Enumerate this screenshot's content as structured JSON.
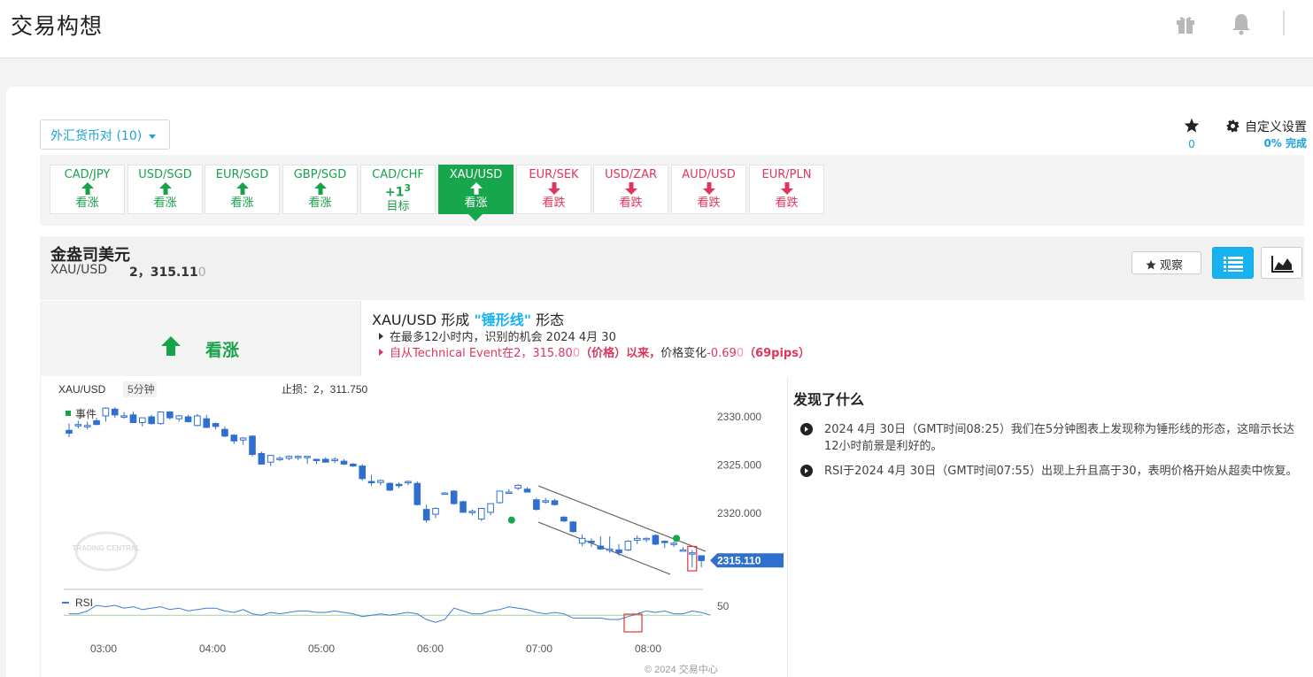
{
  "app": {
    "title": "交易构想"
  },
  "icons": {
    "gift": "gift-icon",
    "bell": "bell-icon",
    "star": "star-icon",
    "gear": "gear-icon",
    "list": "list-icon",
    "area_chart": "area-chart-icon"
  },
  "filter": {
    "label": "外汇货币对 (10)"
  },
  "watchlist": {
    "count": "0"
  },
  "custom_settings": {
    "label": "自定义设置",
    "progress": "0% 完成",
    "progress_value": 0
  },
  "pairs": [
    {
      "symbol": "CAD/JPY",
      "bias": "up",
      "label": "看涨"
    },
    {
      "symbol": "USD/SGD",
      "bias": "up",
      "label": "看涨"
    },
    {
      "symbol": "EUR/SGD",
      "bias": "up",
      "label": "看涨"
    },
    {
      "symbol": "GBP/SGD",
      "bias": "up",
      "label": "看涨"
    },
    {
      "symbol": "CAD/CHF",
      "bias": "target",
      "target_value": "+1",
      "target_sup": "3",
      "label": "目标"
    },
    {
      "symbol": "XAU/USD",
      "bias": "up",
      "label": "看涨",
      "active": true
    },
    {
      "symbol": "EUR/SEK",
      "bias": "down",
      "label": "看跌"
    },
    {
      "symbol": "USD/ZAR",
      "bias": "down",
      "label": "看跌"
    },
    {
      "symbol": "AUD/USD",
      "bias": "down",
      "label": "看跌"
    },
    {
      "symbol": "EUR/PLN",
      "bias": "down",
      "label": "看跌"
    }
  ],
  "instrument": {
    "name": "金盎司美元",
    "symbol": "XAU/USD",
    "price_main": "2，315.11",
    "price_dim": "0"
  },
  "buttons": {
    "watch": "观察"
  },
  "bias": {
    "label": "看涨",
    "color": "#18a34a"
  },
  "pattern": {
    "prefix": "XAU/USD 形成 ",
    "name": "\"锤形线\"",
    "suffix": " 形态",
    "bullet1": "在最多12小时内，识别的机会 2024 4月 30",
    "bullet2_a": "自从Technical Event在2，315.80",
    "bullet2_dim1": "0",
    "bullet2_b": "（价格）以来，",
    "bullet2_c": "价格变化",
    "bullet2_d": "-0.69",
    "bullet2_dim2": "0",
    "bullet2_e": "（69pips）"
  },
  "chart_data": {
    "type": "candlestick",
    "symbol": "XAU/USD",
    "timeframe": "5分钟",
    "stop_loss": "止损：2，311.750",
    "legend": "事件",
    "rsi_label": "RSI",
    "rsi_level": "50",
    "yticks": [
      "2330.000",
      "2325.000",
      "2320.000"
    ],
    "ytick_values": [
      2330,
      2325,
      2320
    ],
    "last_price": "2315.110",
    "last_price_value": 2315.11,
    "xticks": [
      "03:00",
      "04:00",
      "05:00",
      "06:00",
      "07:00",
      "08:00"
    ],
    "xtick_minutes": [
      180,
      240,
      300,
      360,
      420,
      480
    ],
    "copyright": "© 2024 交易中心",
    "watermark": "TRADING CENTRAL",
    "candles": [
      [
        2328.6,
        2329.3,
        2327.9,
        2328.3
      ],
      [
        2329.1,
        2329.6,
        2328.8,
        2329.2
      ],
      [
        2329.0,
        2329.5,
        2328.7,
        2329.1
      ],
      [
        2329.6,
        2329.9,
        2329.3,
        2329.2
      ],
      [
        2330.1,
        2331.0,
        2329.5,
        2330.9
      ],
      [
        2330.8,
        2331.0,
        2329.9,
        2330.2
      ],
      [
        2330.1,
        2330.5,
        2329.8,
        2330.1
      ],
      [
        2330.2,
        2330.5,
        2329.6,
        2329.4
      ],
      [
        2329.4,
        2329.9,
        2329.0,
        2329.9
      ],
      [
        2330.0,
        2330.2,
        2329.2,
        2329.3
      ],
      [
        2329.3,
        2330.4,
        2329.2,
        2330.5
      ],
      [
        2330.5,
        2330.6,
        2329.7,
        2329.9
      ],
      [
        2329.8,
        2330.2,
        2329.5,
        2330.1
      ],
      [
        2330.0,
        2330.2,
        2329.4,
        2329.5
      ],
      [
        2329.1,
        2330.3,
        2329.0,
        2330.1
      ],
      [
        2329.8,
        2330.2,
        2328.9,
        2328.9
      ],
      [
        2329.3,
        2329.4,
        2328.7,
        2329.0
      ],
      [
        2328.7,
        2329.0,
        2327.9,
        2328.0
      ],
      [
        2328.1,
        2328.2,
        2327.2,
        2327.5
      ],
      [
        2327.6,
        2327.9,
        2327.1,
        2327.8
      ],
      [
        2328.0,
        2328.1,
        2325.9,
        2326.1
      ],
      [
        2326.2,
        2326.4,
        2325.1,
        2325.1
      ],
      [
        2325.3,
        2325.6,
        2324.9,
        2326.0
      ],
      [
        2325.6,
        2325.9,
        2325.4,
        2325.7
      ],
      [
        2325.7,
        2326.0,
        2325.5,
        2325.9
      ],
      [
        2325.9,
        2326.0,
        2325.5,
        2325.9
      ],
      [
        2325.9,
        2325.9,
        2325.1,
        2325.9
      ],
      [
        2325.6,
        2325.6,
        2325.1,
        2325.5
      ],
      [
        2325.6,
        2325.8,
        2325.3,
        2325.3
      ],
      [
        2325.5,
        2325.8,
        2325.2,
        2325.6
      ],
      [
        2325.4,
        2325.6,
        2325.0,
        2325.1
      ],
      [
        2325.1,
        2325.2,
        2324.8,
        2324.9
      ],
      [
        2324.9,
        2325.1,
        2323.4,
        2323.6
      ],
      [
        2323.3,
        2324.0,
        2322.8,
        2323.2
      ],
      [
        2323.2,
        2323.5,
        2322.9,
        2323.4
      ],
      [
        2323.1,
        2323.2,
        2322.3,
        2322.4
      ],
      [
        2323.0,
        2323.2,
        2322.6,
        2322.9
      ],
      [
        2323.3,
        2323.4,
        2322.9,
        2323.3
      ],
      [
        2323.1,
        2323.3,
        2320.8,
        2320.9
      ],
      [
        2320.4,
        2320.9,
        2319.0,
        2319.3
      ],
      [
        2319.9,
        2320.6,
        2319.5,
        2320.5
      ],
      [
        2322.1,
        2322.2,
        2322.0,
        2322.1
      ],
      [
        2322.3,
        2322.4,
        2320.9,
        2321.0
      ],
      [
        2321.2,
        2321.3,
        2320.1,
        2320.1
      ],
      [
        2320.2,
        2320.4,
        2319.8,
        2320.2
      ],
      [
        2319.4,
        2320.5,
        2319.2,
        2320.5
      ],
      [
        2320.1,
        2321.0,
        2319.8,
        2321.0
      ],
      [
        2321.1,
        2322.3,
        2321.0,
        2322.3
      ],
      [
        2322.2,
        2322.5,
        2322.0,
        2322.2
      ],
      [
        2322.6,
        2323.0,
        2322.4,
        2322.9
      ],
      [
        2322.5,
        2322.7,
        2322.2,
        2322.2
      ],
      [
        2321.4,
        2321.6,
        2320.3,
        2320.4
      ],
      [
        2321.2,
        2321.6,
        2321.0,
        2321.3
      ],
      [
        2321.3,
        2321.5,
        2320.8,
        2320.9
      ],
      [
        2319.6,
        2319.7,
        2319.1,
        2319.2
      ],
      [
        2319.1,
        2319.2,
        2318.0,
        2318.1
      ],
      [
        2316.9,
        2317.8,
        2316.6,
        2317.4
      ],
      [
        2317.1,
        2317.4,
        2316.5,
        2317.0
      ],
      [
        2316.6,
        2317.6,
        2316.2,
        2316.3
      ],
      [
        2316.3,
        2317.6,
        2315.9,
        2316.3
      ],
      [
        2316.2,
        2316.8,
        2315.6,
        2315.9
      ],
      [
        2316.2,
        2317.2,
        2316.1,
        2317.1
      ],
      [
        2317.2,
        2317.7,
        2316.8,
        2317.4
      ],
      [
        2317.3,
        2317.5,
        2317.0,
        2317.4
      ],
      [
        2317.7,
        2317.8,
        2316.7,
        2316.8
      ],
      [
        2317.1,
        2317.2,
        2316.4,
        2317.0
      ],
      [
        2316.9,
        2317.1,
        2316.5,
        2316.9
      ],
      [
        2316.2,
        2316.5,
        2316.2,
        2316.2
      ],
      [
        2315.9,
        2316.2,
        2314.4,
        2315.9
      ],
      [
        2315.6,
        2315.6,
        2314.4,
        2315.1
      ]
    ],
    "events": [
      {
        "index": 48,
        "value": 2319.3
      },
      {
        "index": 66,
        "value": 2317.4
      }
    ],
    "highlight_index": 68,
    "rsi": [
      44,
      44,
      46,
      50,
      49,
      50,
      48,
      49,
      47,
      48,
      49,
      47,
      48,
      46,
      47,
      48,
      48,
      46,
      45,
      47,
      44,
      43,
      45,
      44,
      45,
      46,
      46,
      45,
      45,
      46,
      45,
      44,
      42,
      43,
      44,
      43,
      44,
      45,
      44,
      40,
      38,
      40,
      48,
      46,
      44,
      44,
      46,
      47,
      49,
      48,
      47,
      45,
      44,
      45,
      44,
      41,
      41,
      41,
      41,
      40,
      40,
      42,
      44,
      46,
      45,
      46,
      44,
      44,
      46,
      45,
      43
    ]
  },
  "findings": {
    "title": "发现了什么",
    "items": [
      "2024 4月 30日（GMT时间08:25）我们在5分钟图表上发现称为锤形线的形态，这暗示长达12小时前景是利好的。",
      "RSI于2024 4月 30日（GMT时间07:55）出现上升且高于30，表明价格开始从超卖中恢复。"
    ]
  }
}
